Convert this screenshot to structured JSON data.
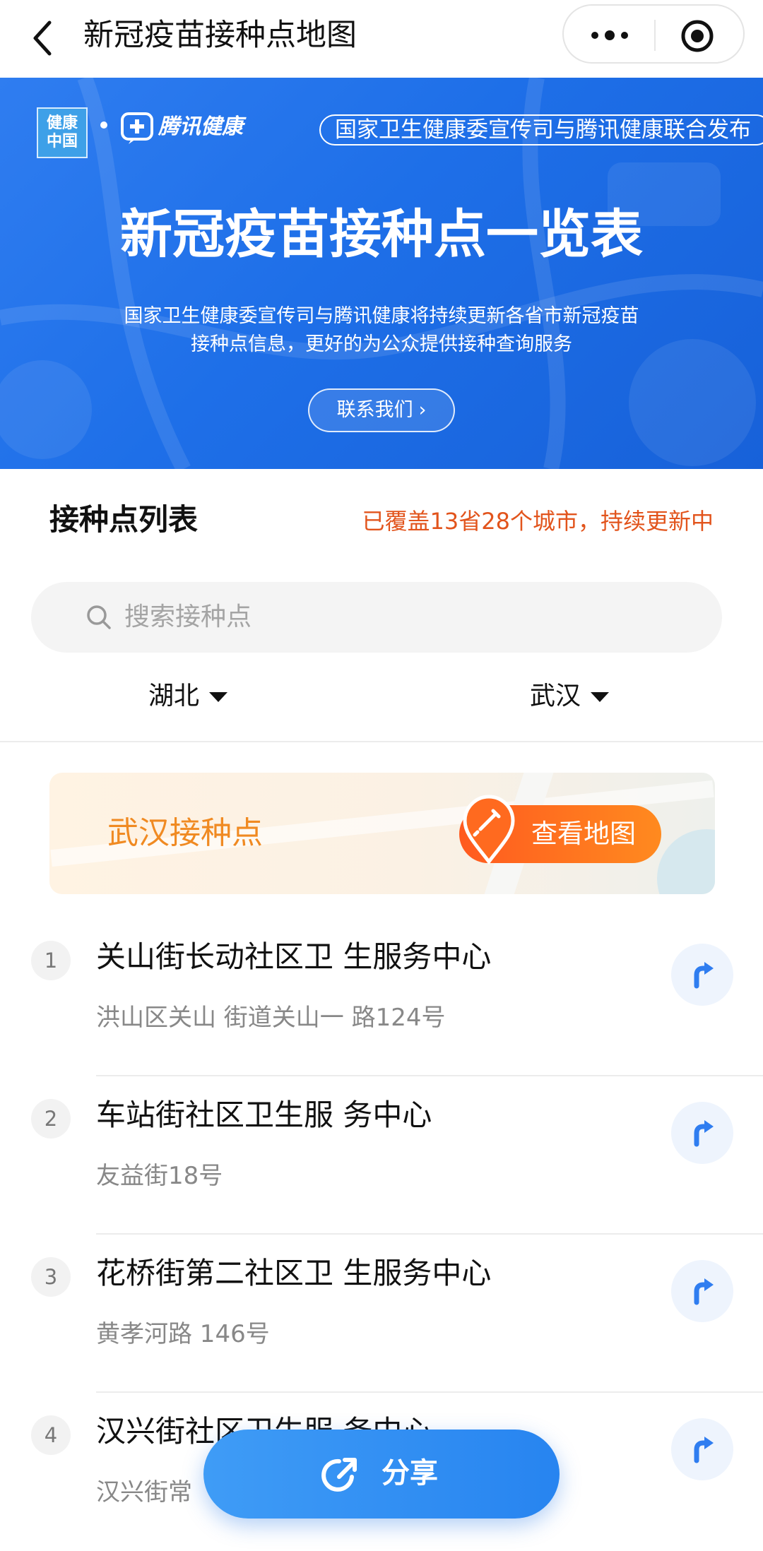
{
  "nav": {
    "title": "新冠疫苗接种点地图"
  },
  "banner": {
    "logo_left_text": "健康中国",
    "logo_right_text": "腾讯健康",
    "publisher": "国家卫生健康委宣传司与腾讯健康联合发布",
    "headline": "新冠疫苗接种点一览表",
    "subtitle_line1": "国家卫生健康委宣传司与腾讯健康将持续更新各省市新冠疫苗",
    "subtitle_line2": "接种点信息，更好的为公众提供接种查询服务",
    "contact_label": "联系我们",
    "contact_chevron": "›"
  },
  "list_header": {
    "title": "接种点列表",
    "coverage": "已覆盖13省28个城市，持续更新中"
  },
  "search": {
    "placeholder": "搜索接种点"
  },
  "filters": {
    "province": "湖北",
    "city": "武汉"
  },
  "city_card": {
    "title": "武汉接种点",
    "map_button": "查看地图"
  },
  "sites": [
    {
      "index": "1",
      "name": "关山街长动社区卫 生服务中心",
      "address": "洪山区关山 街道关山一 路124号"
    },
    {
      "index": "2",
      "name": "车站街社区卫生服 务中心",
      "address": "友益街18号"
    },
    {
      "index": "3",
      "name": "花桥街第二社区卫 生服务中心",
      "address": "黄孝河路 146号"
    },
    {
      "index": "4",
      "name": "汉兴街社区卫生服 务中心",
      "address": "汉兴街常"
    }
  ],
  "share": {
    "label": "分享"
  },
  "colors": {
    "accent_blue": "#2784f0",
    "orange": "#f08a22",
    "coverage_red": "#e2541c"
  },
  "icons": [
    "back-arrow-icon",
    "more-dots-icon",
    "mini-program-close-icon",
    "search-icon",
    "dropdown-triangle-icon",
    "map-pin-icon",
    "navigate-arrow-icon",
    "share-icon"
  ]
}
